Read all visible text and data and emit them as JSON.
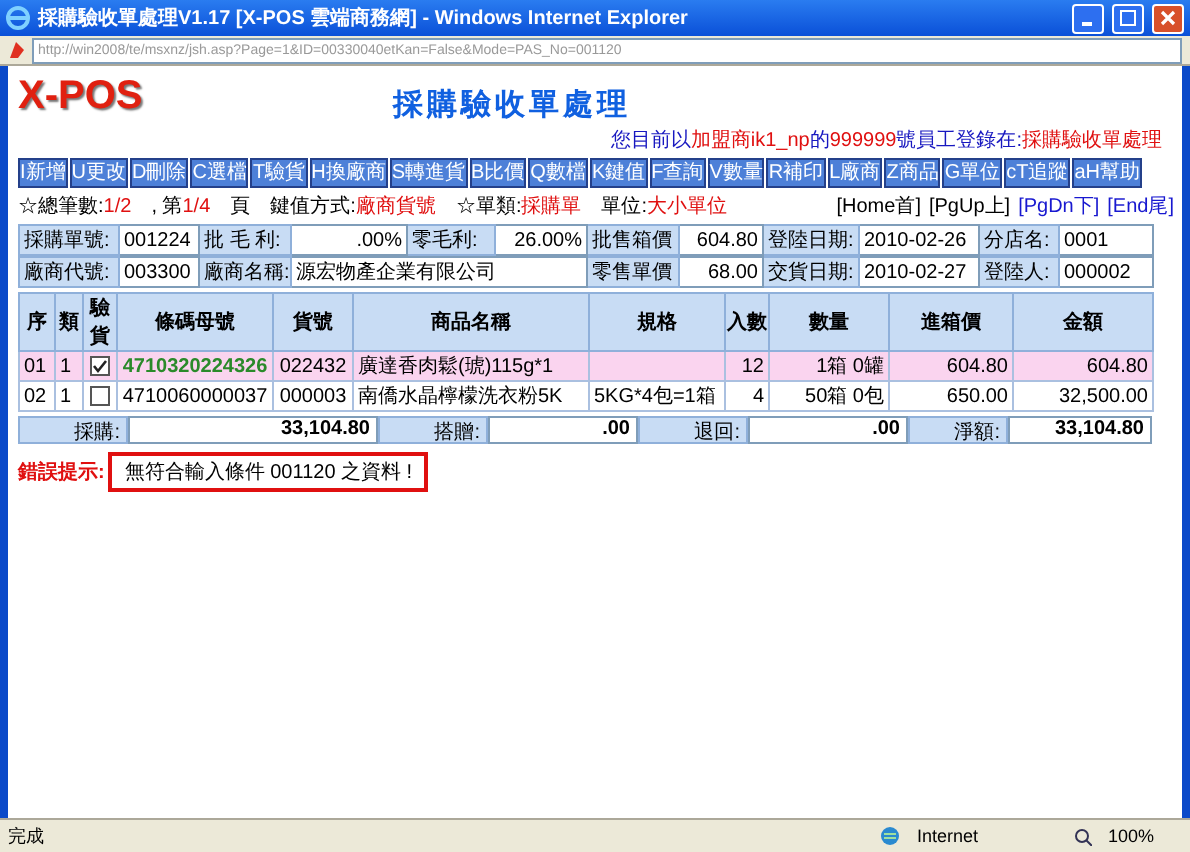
{
  "window": {
    "title": "採購驗收單處理V1.17 [X-POS 雲端商務網] - Windows Internet Explorer"
  },
  "address_bar": {
    "url": "http://win2008/te/msxnz/jsh.asp?Page=1&ID=00330040etKan=False&Mode=PAS_No=001120"
  },
  "header": {
    "logo": "X-POS",
    "heading": "採購驗收單處理",
    "login_info": [
      {
        "text": "您目前以",
        "highlight": false
      },
      {
        "text": "加盟商ik1_np",
        "highlight": true
      },
      {
        "text": "的",
        "highlight": false
      },
      {
        "text": "999999",
        "highlight": true
      },
      {
        "text": "號員工登錄在:",
        "highlight": false
      },
      {
        "text": "採購驗收單處理",
        "highlight": true
      }
    ]
  },
  "toolbar": [
    "I新增",
    "U更改",
    "D刪除",
    "C選檔",
    "T驗貨",
    "H換廠商",
    "S轉進貨",
    "B比價",
    "Q數檔",
    "K鍵值",
    "F查詢",
    "V數量",
    "R補印",
    "L廠商",
    "Z商品",
    "G單位",
    "cT追蹤",
    "aH幫助"
  ],
  "summary": [
    {
      "text": "☆總筆數:",
      "highlight": false
    },
    {
      "text": "1/2",
      "highlight": true
    },
    {
      "text": ", 第",
      "highlight": false
    },
    {
      "text": "1/4",
      "highlight": true
    },
    {
      "text": "頁　鍵值方式:",
      "highlight": false
    },
    {
      "text": "廠商貨號",
      "highlight": true
    },
    {
      "text": "☆單類:",
      "highlight": false
    },
    {
      "text": "採購單",
      "highlight": true
    },
    {
      "text": "單位:",
      "highlight": false
    },
    {
      "text": "大小單位",
      "highlight": true
    }
  ],
  "pager": [
    {
      "label": "[Home首]",
      "disabled": true
    },
    {
      "label": "[PgUp上]",
      "disabled": true
    },
    {
      "label": "[PgDn下]",
      "disabled": false
    },
    {
      "label": "[End尾]",
      "disabled": false
    }
  ],
  "form": {
    "fields": [
      {
        "label": "採購單號:",
        "value": "001224",
        "kind": "text"
      },
      {
        "label": "批 毛 利:",
        "value": ".00%",
        "kind": "number"
      },
      {
        "label": "零毛利:",
        "value": "26.00%",
        "kind": "number"
      },
      {
        "label": "批售箱價",
        "value": "604.80",
        "kind": "number"
      },
      {
        "label": "登陸日期:",
        "value": "2010-02-26",
        "kind": "text"
      },
      {
        "label": "分店名:",
        "value": "0001",
        "kind": "text"
      },
      {
        "label": "廠商代號:",
        "value": "003300",
        "kind": "text"
      },
      {
        "label": "廠商名稱:",
        "value": "源宏物產企業有限公司",
        "kind": "text"
      },
      {
        "label": "零售單價",
        "value": "68.00",
        "kind": "number"
      },
      {
        "label": "交貨日期:",
        "value": "2010-02-27",
        "kind": "text"
      },
      {
        "label": "登陸人:",
        "value": "000002",
        "kind": "text"
      }
    ]
  },
  "table": {
    "columns": [
      "序",
      "類",
      "驗貨",
      "條碼母號",
      "貨號",
      "商品名稱",
      "規格",
      "入數",
      "數量",
      "進箱價",
      "金額"
    ],
    "rows": [
      {
        "selected": true,
        "checked": true,
        "seq": "01",
        "type": "1",
        "barcode": "4710320224326",
        "item_no": "022432",
        "name": "廣達香肉鬆(琥)115g*1",
        "spec": "",
        "pack": "12",
        "qty": "1箱 0罐",
        "price": "604.80",
        "amount": "604.80"
      },
      {
        "selected": false,
        "checked": false,
        "seq": "02",
        "type": "1",
        "barcode": "4710060000037",
        "item_no": "000003",
        "name": "南僑水晶檸檬洗衣粉5K",
        "spec": "5KG*4包=1箱",
        "pack": "4",
        "qty": "50箱 0包",
        "price": "650.00",
        "amount": "32,500.00"
      }
    ]
  },
  "totals": [
    {
      "label": "採購:",
      "value": "33,104.80"
    },
    {
      "label": "搭贈:",
      "value": ".00"
    },
    {
      "label": "退回:",
      "value": ".00"
    },
    {
      "label": "淨額:",
      "value": "33,104.80"
    }
  ],
  "error": {
    "label": "錯誤提示:",
    "message": "無符合輸入條件 001120 之資料 !"
  },
  "status_bar": {
    "text": "完成",
    "zone": "Internet",
    "zoom": "100%"
  }
}
